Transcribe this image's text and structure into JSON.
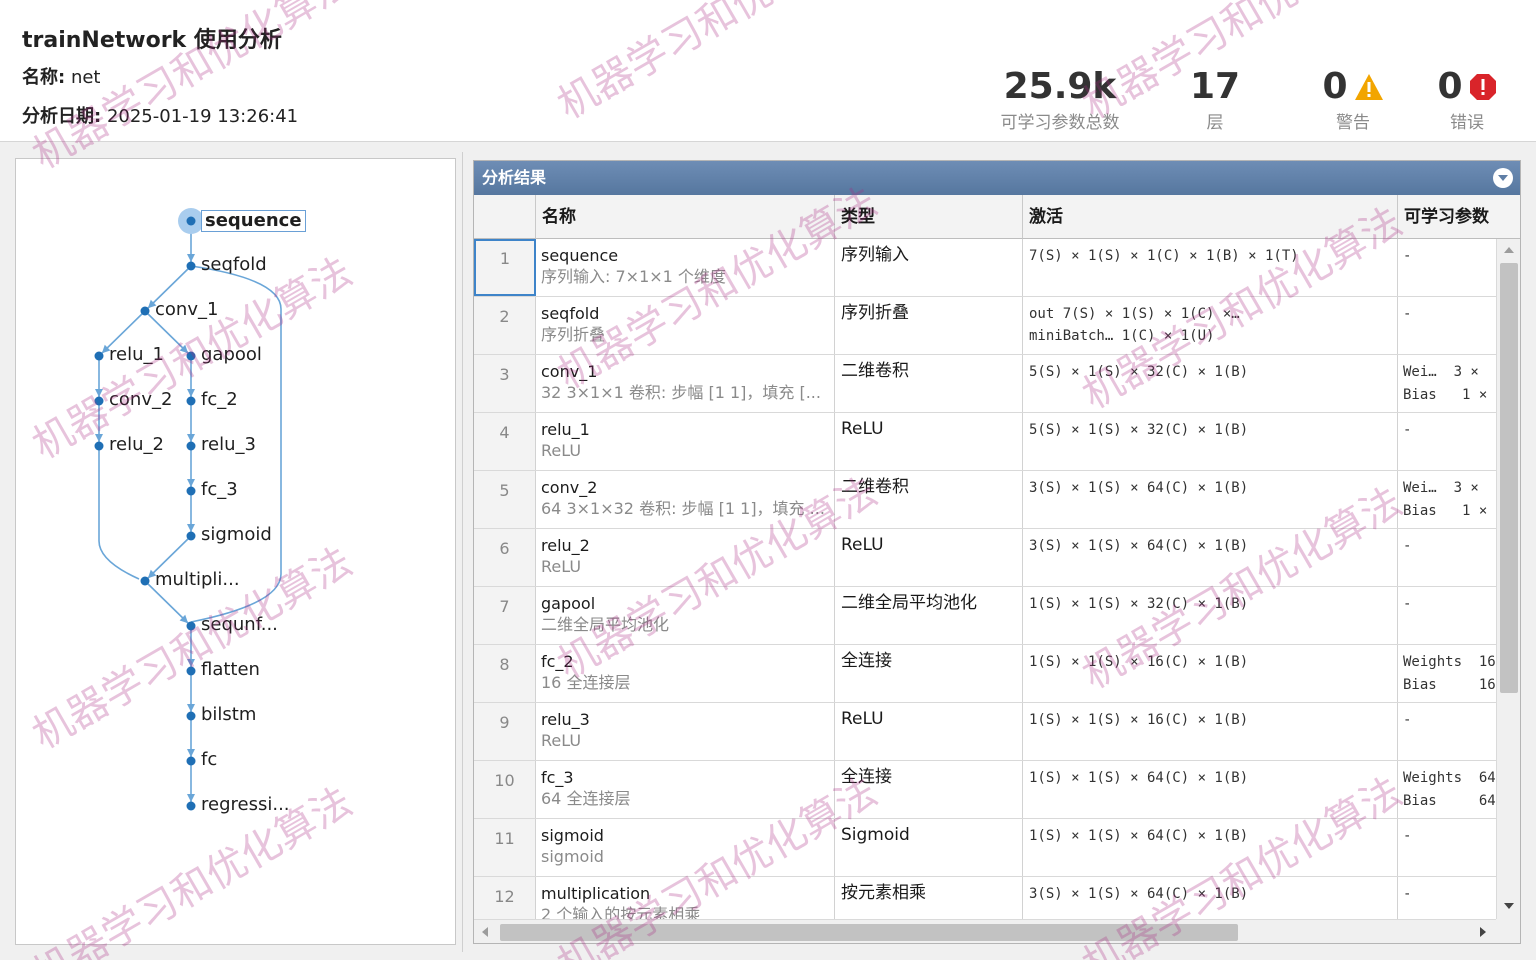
{
  "header": {
    "title": "trainNetwork 使用分析",
    "name_label": "名称:",
    "name_value": "net",
    "date_label": "分析日期:",
    "date_value": "2025-01-19 13:26:41"
  },
  "stats": {
    "params_value": "25.9k",
    "params_label": "可学习参数总数",
    "layers_value": "17",
    "layers_label": "层",
    "warnings_value": "0",
    "warnings_label": "警告",
    "errors_value": "0",
    "errors_label": "错误",
    "warning_color": "#f2a500",
    "error_color": "#d9242a"
  },
  "graph": {
    "selected": "sequence",
    "nodes": [
      {
        "id": "sequence",
        "label": "sequence"
      },
      {
        "id": "seqfold",
        "label": "seqfold"
      },
      {
        "id": "conv_1",
        "label": "conv_1"
      },
      {
        "id": "relu_1",
        "label": "relu_1"
      },
      {
        "id": "gapool",
        "label": "gapool"
      },
      {
        "id": "conv_2",
        "label": "conv_2"
      },
      {
        "id": "fc_2",
        "label": "fc_2"
      },
      {
        "id": "relu_2",
        "label": "relu_2"
      },
      {
        "id": "relu_3",
        "label": "relu_3"
      },
      {
        "id": "fc_3",
        "label": "fc_3"
      },
      {
        "id": "sigmoid",
        "label": "sigmoid"
      },
      {
        "id": "multiplication",
        "label": "multipli..."
      },
      {
        "id": "sequnfold",
        "label": "sequnf..."
      },
      {
        "id": "flatten",
        "label": "flatten"
      },
      {
        "id": "bilstm",
        "label": "bilstm"
      },
      {
        "id": "fc",
        "label": "fc"
      },
      {
        "id": "regression",
        "label": "regressi..."
      }
    ],
    "edge_color": "#6aa6d8",
    "node_color": "#1f6fb5"
  },
  "results": {
    "title": "分析结果",
    "columns": [
      "名称",
      "类型",
      "激活",
      "可学习参数"
    ],
    "active_row": 1,
    "rows": [
      {
        "idx": "1",
        "name": "sequence",
        "desc": "序列输入: 7×1×1 个维度",
        "type": "序列输入",
        "act": "7(S) × 1(S) × 1(C) × 1(B) × 1(T)",
        "act2": "",
        "param1": "-",
        "param2": ""
      },
      {
        "idx": "2",
        "name": "seqfold",
        "desc": "序列折叠",
        "type": "序列折叠",
        "act": "out         7(S) × 1(S) × 1(C) ×…",
        "act2": "miniBatch…  1(C) × 1(U)",
        "param1": "-",
        "param2": ""
      },
      {
        "idx": "3",
        "name": "conv_1",
        "desc": "32 3×1×1 卷积: 步幅 [1 1]，填充 [...",
        "type": "二维卷积",
        "act": "5(S) × 1(S) × 32(C) × 1(B)",
        "act2": "",
        "param1": "Wei…  3 ×",
        "param2": "Bias   1 ×"
      },
      {
        "idx": "4",
        "name": "relu_1",
        "desc": "ReLU",
        "type": "ReLU",
        "act": "5(S) × 1(S) × 32(C) × 1(B)",
        "act2": "",
        "param1": "-",
        "param2": ""
      },
      {
        "idx": "5",
        "name": "conv_2",
        "desc": "64 3×1×32 卷积: 步幅 [1 1]，填充 ...",
        "type": "二维卷积",
        "act": "3(S) × 1(S) × 64(C) × 1(B)",
        "act2": "",
        "param1": "Wei…  3 ×",
        "param2": "Bias   1 ×"
      },
      {
        "idx": "6",
        "name": "relu_2",
        "desc": "ReLU",
        "type": "ReLU",
        "act": "3(S) × 1(S) × 64(C) × 1(B)",
        "act2": "",
        "param1": "-",
        "param2": ""
      },
      {
        "idx": "7",
        "name": "gapool",
        "desc": "二维全局平均池化",
        "type": "二维全局平均池化",
        "act": "1(S) × 1(S) × 32(C) × 1(B)",
        "act2": "",
        "param1": "-",
        "param2": ""
      },
      {
        "idx": "8",
        "name": "fc_2",
        "desc": "16 全连接层",
        "type": "全连接",
        "act": "1(S) × 1(S) × 16(C) × 1(B)",
        "act2": "",
        "param1": "Weights  16",
        "param2": "Bias     16"
      },
      {
        "idx": "9",
        "name": "relu_3",
        "desc": "ReLU",
        "type": "ReLU",
        "act": "1(S) × 1(S) × 16(C) × 1(B)",
        "act2": "",
        "param1": "-",
        "param2": ""
      },
      {
        "idx": "10",
        "name": "fc_3",
        "desc": "64 全连接层",
        "type": "全连接",
        "act": "1(S) × 1(S) × 64(C) × 1(B)",
        "act2": "",
        "param1": "Weights  64",
        "param2": "Bias     64"
      },
      {
        "idx": "11",
        "name": "sigmoid",
        "desc": "sigmoid",
        "type": "Sigmoid",
        "act": "1(S) × 1(S) × 64(C) × 1(B)",
        "act2": "",
        "param1": "-",
        "param2": ""
      },
      {
        "idx": "12",
        "name": "multiplication",
        "desc": "2 个输入的按元素相乘",
        "type": "按元素相乘",
        "act": "3(S) × 1(S) × 64(C) × 1(B)",
        "act2": "",
        "param1": "-",
        "param2": ""
      }
    ]
  },
  "watermark": {
    "text": "机器学习和优化算法"
  }
}
